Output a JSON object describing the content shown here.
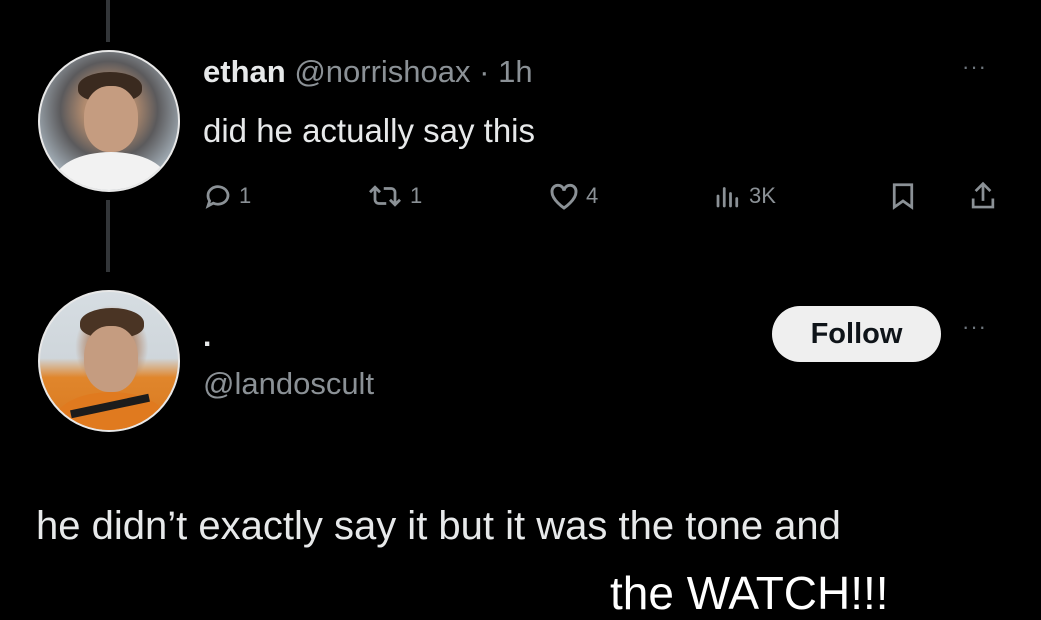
{
  "tweet": {
    "display_name": "ethan",
    "handle": "@norrishoax",
    "separator": "·",
    "time": "1h",
    "text": "did he actually say this",
    "more_label": "···",
    "stats": {
      "replies": "1",
      "reposts": "1",
      "likes": "4",
      "views": "3K"
    },
    "icons": [
      "reply-icon",
      "repost-icon",
      "like-icon",
      "views-icon",
      "bookmark-icon",
      "share-icon"
    ]
  },
  "reply_user": {
    "display_name": ".",
    "handle": "@landoscult",
    "follow_label": "Follow",
    "more_label": "···"
  },
  "reply_text": "he didn’t exactly say it but it was the tone and",
  "caption": "the WATCH!!!",
  "colors": {
    "background": "#000000",
    "primary_text": "#e7e9ea",
    "secondary_text": "#8b9196",
    "follow_button_bg": "#efefef"
  }
}
